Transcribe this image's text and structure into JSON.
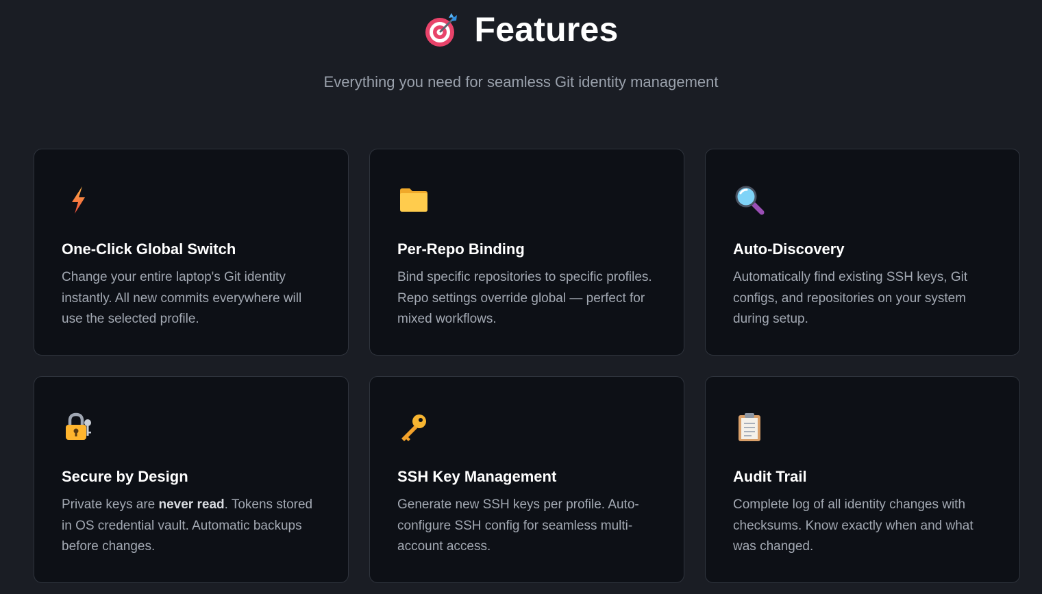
{
  "header": {
    "title": "Features",
    "title_icon": "target-dart-icon",
    "subtitle": "Everything you need for seamless Git identity management"
  },
  "features": [
    {
      "icon": "lightning-bolt-icon",
      "title": "One-Click Global Switch",
      "description": "Change your entire laptop's Git identity instantly. All new commits everywhere will use the selected profile."
    },
    {
      "icon": "folder-icon",
      "title": "Per-Repo Binding",
      "description": "Bind specific repositories to specific profiles. Repo settings override global — perfect for mixed workflows."
    },
    {
      "icon": "magnifying-glass-icon",
      "title": "Auto-Discovery",
      "description": "Automatically find existing SSH keys, Git configs, and repositories on your system during setup."
    },
    {
      "icon": "lock-with-key-icon",
      "title": "Secure by Design",
      "description_before": "Private keys are ",
      "description_bold": "never read",
      "description_after": ". Tokens stored in OS credential vault. Automatic backups before changes."
    },
    {
      "icon": "key-icon",
      "title": "SSH Key Management",
      "description": "Generate new SSH keys per profile. Auto-configure SSH config for seamless multi-account access."
    },
    {
      "icon": "clipboard-icon",
      "title": "Audit Trail",
      "description": "Complete log of all identity changes with checksums. Know exactly when and what was changed."
    }
  ],
  "colors": {
    "background": "#1a1d24",
    "card_background": "#0d1016",
    "card_border": "#2f343d",
    "title": "#ffffff",
    "muted_text": "#a3a9b3"
  }
}
